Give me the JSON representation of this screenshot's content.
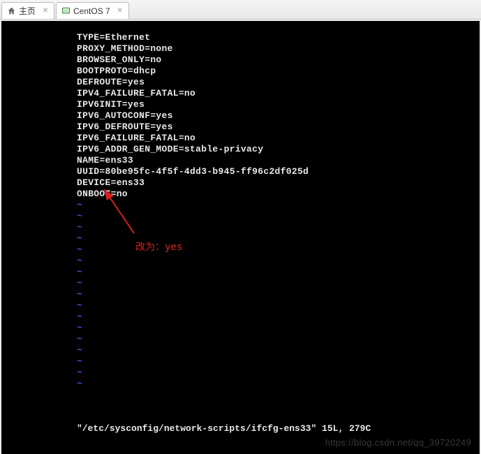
{
  "tabs": [
    {
      "label": "主页",
      "icon": "home"
    },
    {
      "label": "CentOS 7",
      "icon": "vm"
    }
  ],
  "config": {
    "lines": [
      "TYPE=Ethernet",
      "PROXY_METHOD=none",
      "BROWSER_ONLY=no",
      "BOOTPROTO=dhcp",
      "DEFROUTE=yes",
      "IPV4_FAILURE_FATAL=no",
      "IPV6INIT=yes",
      "IPV6_AUTOCONF=yes",
      "IPV6_DEFROUTE=yes",
      "IPV6_FAILURE_FATAL=no",
      "IPV6_ADDR_GEN_MODE=stable-privacy",
      "NAME=ens33",
      "UUID=80be95fc-4f5f-4dd3-b945-ff96c2df025d",
      "DEVICE=ens33",
      "ONBOOT=no"
    ]
  },
  "tilde_count": 17,
  "annotation": {
    "text": "改为：yes",
    "arrow_color": "#d82020"
  },
  "status_line": "\"/etc/sysconfig/network-scripts/ifcfg-ens33\" 15L, 279C",
  "watermark": "https://blog.csdn.net/qq_39720249"
}
